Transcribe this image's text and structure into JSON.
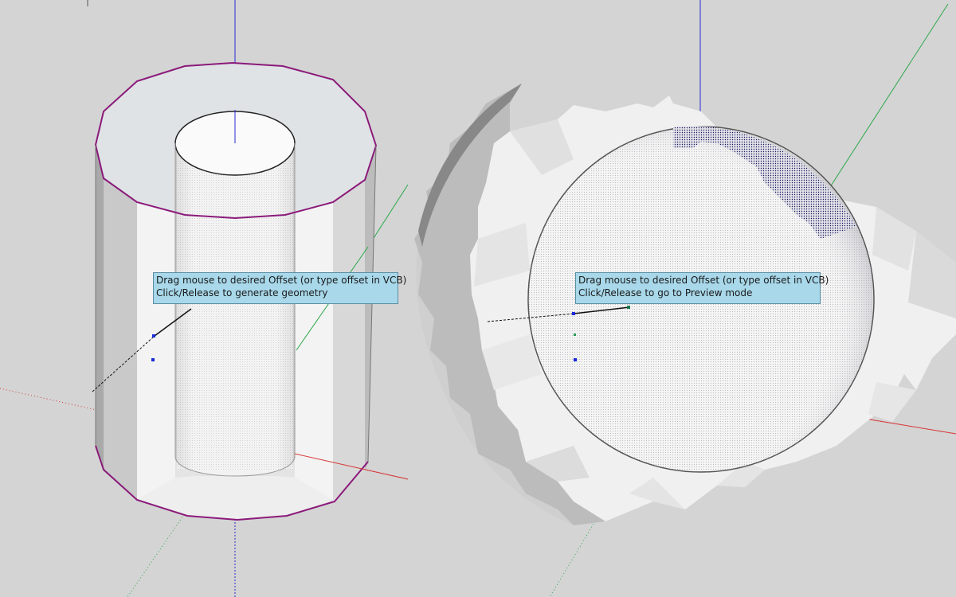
{
  "app": "SketchUp Offset Tool Viewport",
  "colors": {
    "background": "#d4d4d4",
    "axis_blue": "#2a2ad0",
    "axis_red": "#d83a3a",
    "axis_green": "#2aa84a",
    "edge_selected": "#8b1a7a",
    "tooltip_bg": "#a8d8ea",
    "tooltip_border": "#5b8ea3"
  },
  "tooltips": {
    "left": {
      "line1": "Drag mouse to desired Offset (or type offset in VCB)",
      "line2": "Click/Release to generate geometry"
    },
    "right": {
      "line1": "Drag mouse to desired Offset (or type offset in VCB)",
      "line2": "Click/Release to go to Preview mode"
    }
  },
  "icons": {
    "cursor_point": "square-point-marker",
    "inference_point": "green-endpoint-marker"
  }
}
